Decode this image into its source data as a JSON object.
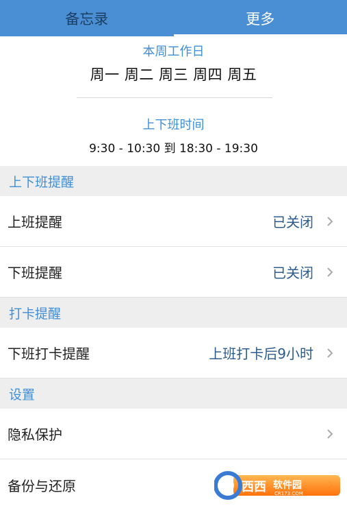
{
  "tabs": [
    {
      "label": "备忘录",
      "active": false
    },
    {
      "label": "更多",
      "active": true
    }
  ],
  "summary": {
    "workdays_label": "本周工作日",
    "workdays_value": "周一 周二 周三 周四 周五",
    "time_label": "上下班时间",
    "time_value": "9:30 - 10:30 到 18:30 - 19:30"
  },
  "sections": {
    "commute_reminder": {
      "title": "上下班提醒",
      "items": [
        {
          "label": "上班提醒",
          "value": "已关闭"
        },
        {
          "label": "下班提醒",
          "value": "已关闭"
        }
      ]
    },
    "clock_reminder": {
      "title": "打卡提醒",
      "items": [
        {
          "label": "下班打卡提醒",
          "value": "上班打卡后9小时"
        }
      ]
    },
    "settings": {
      "title": "设置",
      "items": [
        {
          "label": "隐私保护",
          "value": ""
        },
        {
          "label": "备份与还原",
          "value": ""
        }
      ]
    }
  },
  "watermark": {
    "text": "西西软件园",
    "subtext": "CR173.COM"
  },
  "colors": {
    "tabbar": "#4a8fd4",
    "accent": "#3f8fd8",
    "value": "#2c5c8f",
    "section_bg": "#eeeeee"
  }
}
